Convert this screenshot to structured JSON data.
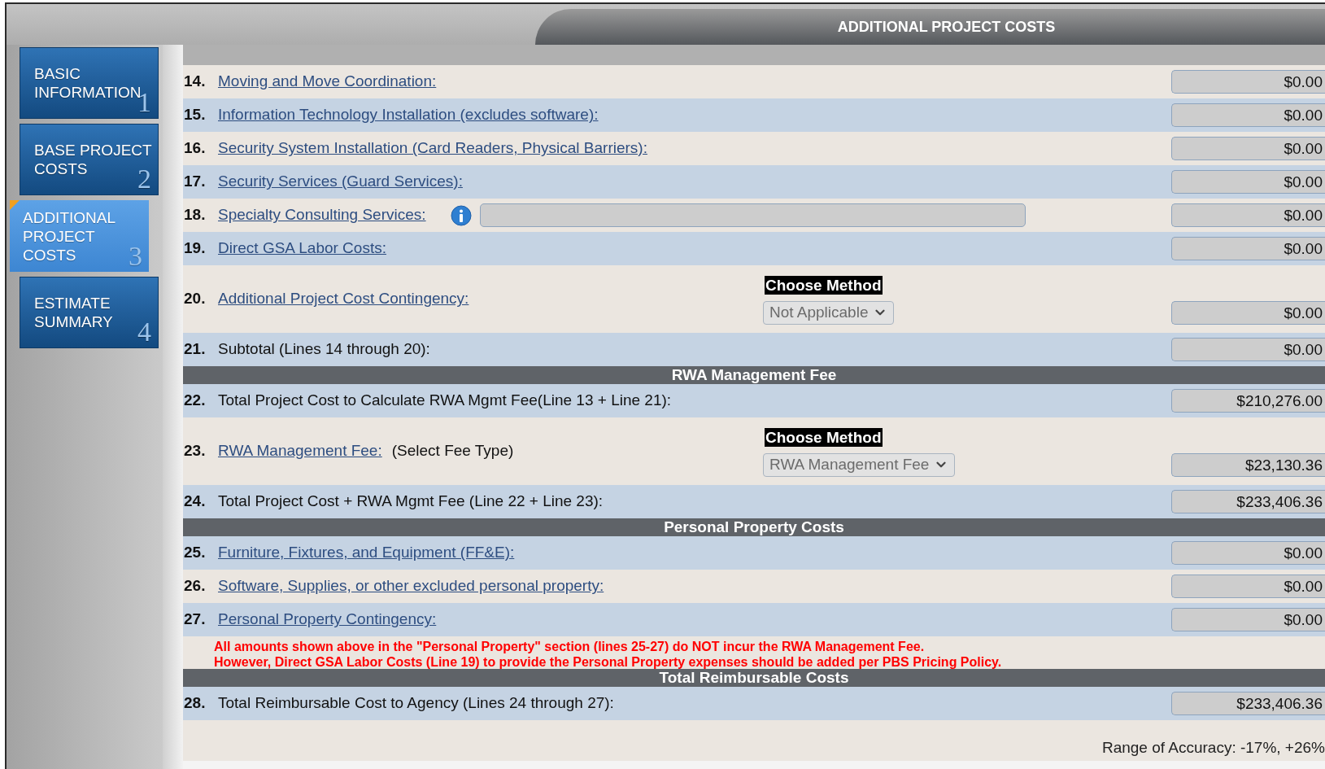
{
  "header": {
    "title": "ADDITIONAL PROJECT COSTS"
  },
  "sidebar": {
    "items": [
      {
        "lines": [
          "BASIC",
          "INFORMATION"
        ],
        "number": "1",
        "selected": false
      },
      {
        "lines": [
          "BASE PROJECT",
          "COSTS"
        ],
        "number": "2",
        "selected": false
      },
      {
        "lines": [
          "ADDITIONAL",
          "PROJECT",
          "COSTS"
        ],
        "number": "3",
        "selected": true
      },
      {
        "lines": [
          "ESTIMATE",
          "SUMMARY"
        ],
        "number": "4",
        "selected": false
      }
    ]
  },
  "rows": [
    {
      "kind": "line",
      "shaded": false,
      "number": "14.",
      "label": "Moving and Move Coordination:",
      "link": true,
      "amount": "$0.00"
    },
    {
      "kind": "line",
      "shaded": true,
      "number": "15.",
      "label": "Information Technology Installation (excludes software):",
      "link": true,
      "amount": "$0.00"
    },
    {
      "kind": "line",
      "shaded": false,
      "number": "16.",
      "label": "Security System Installation (Card Readers, Physical Barriers):",
      "link": true,
      "amount": "$0.00"
    },
    {
      "kind": "line",
      "shaded": true,
      "number": "17.",
      "label": "Security Services (Guard Services):",
      "link": true,
      "amount": "$0.00"
    },
    {
      "kind": "line",
      "shaded": false,
      "number": "18.",
      "label": "Specialty Consulting Services:",
      "link": true,
      "info_icon": true,
      "detail_field": true,
      "amount": "$0.00"
    },
    {
      "kind": "line",
      "shaded": true,
      "number": "19.",
      "label": "Direct GSA Labor Costs:",
      "link": true,
      "amount": "$0.00"
    },
    {
      "kind": "line",
      "shaded": false,
      "number": "20.",
      "label": "Additional Project Cost Contingency:",
      "link": true,
      "method": {
        "caption": "Choose Method",
        "value": "Not Applicable"
      },
      "amount": "$0.00"
    },
    {
      "kind": "line",
      "shaded": true,
      "number": "21.",
      "label": "Subtotal (Lines 14 through 20):",
      "link": false,
      "amount": "$0.00"
    },
    {
      "kind": "section",
      "title": "RWA Management Fee"
    },
    {
      "kind": "line",
      "shaded": true,
      "number": "22.",
      "label": "Total Project Cost to Calculate RWA Mgmt Fee(Line 13 + Line 21):",
      "link": false,
      "amount": "$210,276.00"
    },
    {
      "kind": "line",
      "shaded": false,
      "number": "23.",
      "label": "RWA Management Fee:",
      "link": true,
      "suffix": "(Select Fee Type)",
      "method": {
        "caption": "Choose Method",
        "value": "RWA Management Fee"
      },
      "amount": "$23,130.36"
    },
    {
      "kind": "line",
      "shaded": true,
      "number": "24.",
      "label": "Total Project Cost + RWA Mgmt Fee (Line 22 + Line 23):",
      "link": false,
      "amount": "$233,406.36"
    },
    {
      "kind": "section",
      "title": "Personal Property Costs"
    },
    {
      "kind": "line",
      "shaded": true,
      "number": "25.",
      "label": "Furniture, Fixtures, and Equipment (FF&E):",
      "link": true,
      "amount": "$0.00"
    },
    {
      "kind": "line",
      "shaded": false,
      "number": "26.",
      "label": "Software, Supplies, or other excluded personal property:",
      "link": true,
      "amount": "$0.00"
    },
    {
      "kind": "line",
      "shaded": true,
      "number": "27.",
      "label": "Personal Property Contingency:",
      "link": true,
      "amount": "$0.00"
    },
    {
      "kind": "note",
      "lines": [
        "All amounts shown above in the \"Personal Property\" section (lines 25-27) do NOT incur the RWA Management Fee.",
        "However, Direct GSA Labor Costs (Line 19) to provide the Personal Property expenses should be added per PBS Pricing Policy."
      ]
    },
    {
      "kind": "section",
      "title": "Total Reimbursable Costs"
    },
    {
      "kind": "line",
      "shaded": true,
      "number": "28.",
      "label": "Total Reimbursable Cost to Agency (Lines 24 through 27):",
      "link": false,
      "amount": "$233,406.36"
    },
    {
      "kind": "footer",
      "text": "Range of Accuracy: -17%, +26%"
    }
  ]
}
